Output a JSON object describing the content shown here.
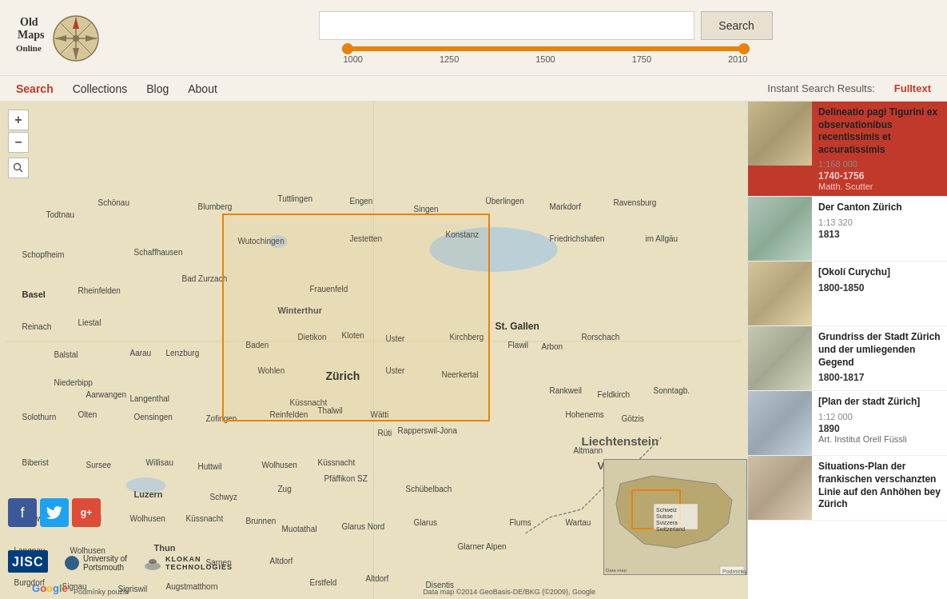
{
  "header": {
    "logo_alt": "Old Maps Online",
    "search_placeholder": "",
    "search_button_label": "Search",
    "slider_labels": [
      "1000",
      "1250",
      "1500",
      "1750",
      "2010"
    ]
  },
  "navbar": {
    "items": [
      {
        "id": "search",
        "label": "Search",
        "active": true
      },
      {
        "id": "collections",
        "label": "Collections",
        "active": false
      },
      {
        "id": "blog",
        "label": "Blog",
        "active": false
      },
      {
        "id": "about",
        "label": "About",
        "active": false
      }
    ],
    "instant_search_label": "Instant Search Results:",
    "fulltext_label": "Fulltext"
  },
  "results": [
    {
      "id": 1,
      "title": "Delineatio pagi Tigurini ex observationibus recentissimis et accuratissimis",
      "scale": "1:168 000",
      "date": "1740-1756",
      "date_separator": " - ",
      "author": "Matth. Scutter",
      "highlighted": true,
      "thumb_class": "thumb1"
    },
    {
      "id": 2,
      "title": "Der Canton Zürich",
      "scale": "1:13 320",
      "date": "1813",
      "date_separator": " - ",
      "author": "",
      "highlighted": false,
      "thumb_class": "thumb2"
    },
    {
      "id": 3,
      "title": "[Okolí Curychu]",
      "scale": "",
      "date": "1800-1850",
      "date_separator": " - ",
      "author": "",
      "highlighted": false,
      "thumb_class": "thumb3"
    },
    {
      "id": 4,
      "title": "Grundriss der Stadt Zürich und der umliegenden Gegend",
      "scale": "",
      "date": "1800-1817",
      "date_separator": " - ",
      "author": "",
      "highlighted": false,
      "thumb_class": "thumb4"
    },
    {
      "id": 5,
      "title": "[Plan der stadt Zürich]",
      "scale": "1:12 000",
      "date": "1890",
      "date_separator": " - ",
      "author": "Art. Institut Orell Füssli",
      "highlighted": false,
      "thumb_class": "thumb5"
    },
    {
      "id": 6,
      "title": "Situations-Plan der frankischen verschanzten Linie auf den Anhöhen bey Zürich",
      "scale": "",
      "date": "",
      "date_separator": "",
      "author": "",
      "highlighted": false,
      "thumb_class": "thumb6"
    }
  ],
  "social": {
    "facebook_label": "f",
    "twitter_label": "🐦",
    "googleplus_label": "g+"
  },
  "map": {
    "attribution": "Data map ©2014 GeoBasis-DE/BKG (©2009), Google",
    "terms": "Podmínky použití",
    "google": "Google",
    "mini_label": "Schweiz\nSuisse\nSvizzera\nSwitzerland"
  },
  "bottom_logos": {
    "jisc": "JISC",
    "portsmouth": "University of\nPortsmouth",
    "klokan": "KLOKAN\nTECHNOLOGIES"
  }
}
